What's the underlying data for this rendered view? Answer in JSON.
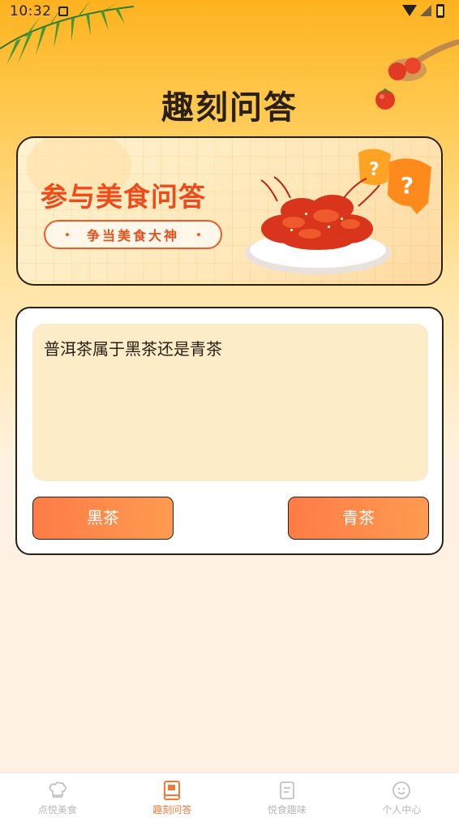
{
  "status_bar": {
    "time": "10:32"
  },
  "header": {
    "title": "趣刻问答"
  },
  "banner": {
    "heading": "参与美食问答",
    "subtitle": "争当美食大神",
    "accent_color": "#f04a1a",
    "image_name": "crayfish-dish"
  },
  "quiz": {
    "question": "普洱茶属于黑茶还是青茶",
    "options": [
      "黑茶",
      "青茶"
    ],
    "button_color": "#ff8548"
  },
  "tab_bar": {
    "active_index": 1,
    "tabs": [
      {
        "label": "点悦美食",
        "icon": "chef-hat-icon"
      },
      {
        "label": "趣刻问答",
        "icon": "book-icon"
      },
      {
        "label": "悦食趣味",
        "icon": "note-icon"
      },
      {
        "label": "个人中心",
        "icon": "smiley-icon"
      }
    ],
    "active_color": "#f07a3a",
    "inactive_color": "#b9b9b9"
  }
}
